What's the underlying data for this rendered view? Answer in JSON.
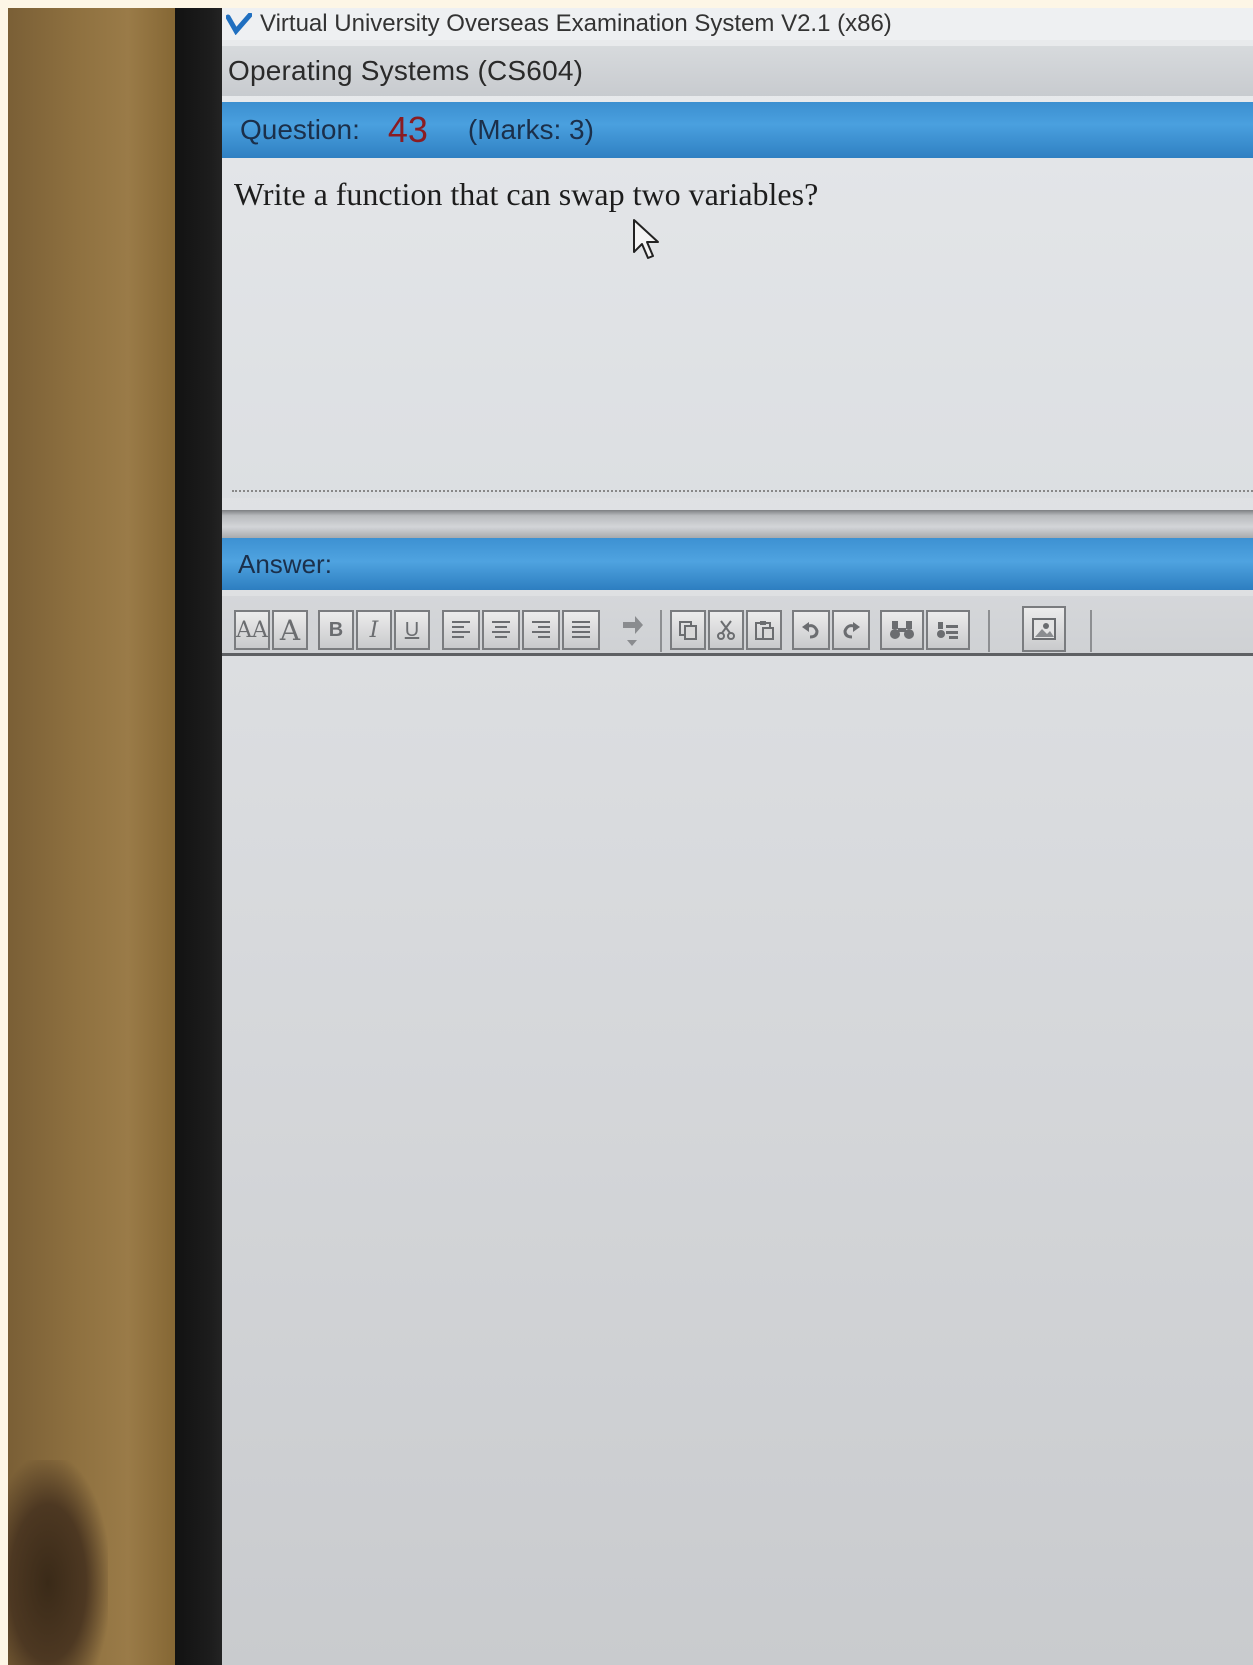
{
  "window": {
    "title": "Virtual University Overseas Examination System  V2.1 (x86)"
  },
  "course": {
    "title": "Operating Systems  (CS604)"
  },
  "question": {
    "label": "Question:",
    "number": "43",
    "marks": "(Marks: 3)",
    "text": "Write a function that can swap two variables?"
  },
  "answer": {
    "label": "Answer:",
    "content": ""
  },
  "toolbar": {
    "buttons": [
      {
        "name": "decrease-font-size",
        "icon": "font-size-decrease-icon"
      },
      {
        "name": "increase-font-size",
        "icon": "font-size-increase-icon"
      },
      {
        "name": "bold",
        "icon": "bold-icon",
        "label": "B"
      },
      {
        "name": "italic",
        "icon": "italic-icon",
        "label": "I"
      },
      {
        "name": "underline",
        "icon": "underline-icon",
        "label": "U"
      },
      {
        "name": "align-left",
        "icon": "align-left-icon"
      },
      {
        "name": "align-center",
        "icon": "align-center-icon"
      },
      {
        "name": "align-right",
        "icon": "align-right-icon"
      },
      {
        "name": "justify",
        "icon": "align-justify-icon"
      },
      {
        "name": "insert-symbol",
        "icon": "insert-symbol-icon"
      },
      {
        "name": "copy",
        "icon": "copy-icon"
      },
      {
        "name": "cut",
        "icon": "cut-icon"
      },
      {
        "name": "paste",
        "icon": "paste-icon"
      },
      {
        "name": "undo",
        "icon": "undo-icon"
      },
      {
        "name": "redo",
        "icon": "redo-icon"
      },
      {
        "name": "find",
        "icon": "find-binoculars-icon"
      },
      {
        "name": "replace",
        "icon": "replace-icon"
      },
      {
        "name": "insert-image",
        "icon": "insert-image-icon"
      }
    ]
  },
  "colors": {
    "header_blue": "#3b8fd0",
    "question_number": "#8a1c22"
  }
}
